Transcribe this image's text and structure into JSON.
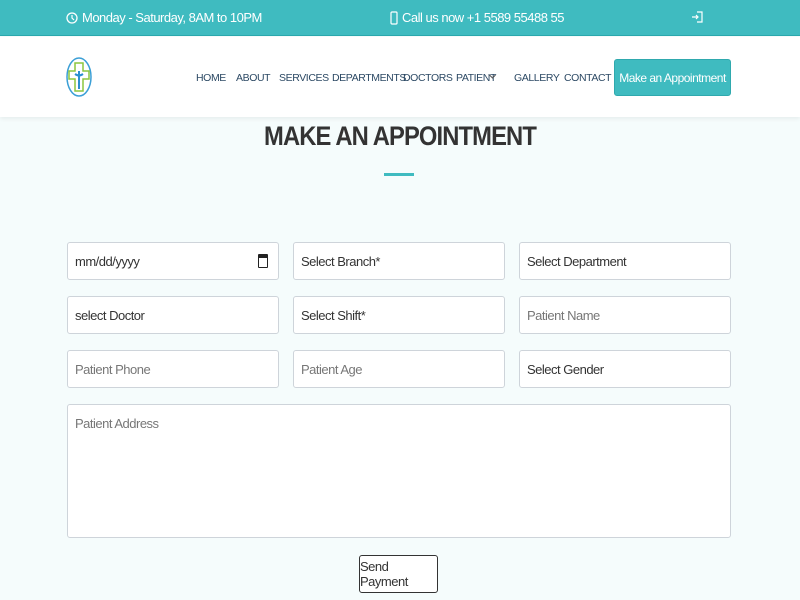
{
  "topbar": {
    "hours": "Monday - Saturday, 8AM to 10PM",
    "phone": "Call us now +1 5589 55488 55",
    "icons": [
      "clock-icon",
      "phone-icon",
      "login-icon"
    ]
  },
  "nav": {
    "items": [
      "HOME",
      "ABOUT",
      "SERVICES",
      "DEPARTMENTS",
      "DOCTORS",
      "PATIENT",
      "GALLERY",
      "CONTACT"
    ],
    "cta": "Make an Appointment"
  },
  "colors": {
    "accent": "#3fbbc0"
  },
  "form": {
    "title": "MAKE AN APPOINTMENT",
    "date": "mm/dd/yyyy",
    "branch": "Select Branch*",
    "department": "Select Department",
    "doctor": "select Doctor",
    "shift": "Select Shift*",
    "name_ph": "Patient Name",
    "phone_ph": "Patient Phone",
    "age_ph": "Patient Age",
    "gender": "Select Gender",
    "address_ph": "Patient Address",
    "submit": "Send Payment"
  }
}
